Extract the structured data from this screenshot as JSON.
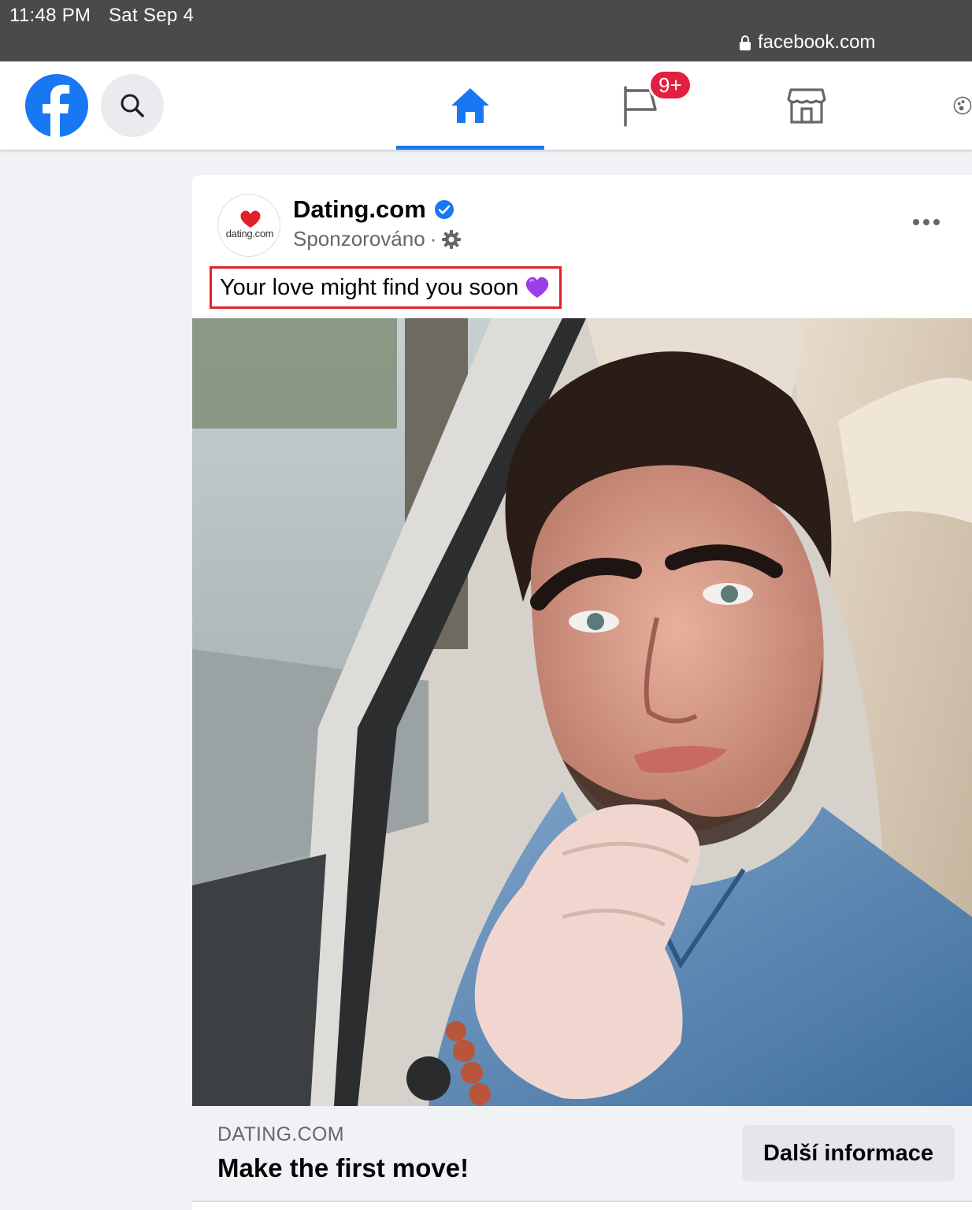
{
  "status_bar": {
    "time": "11:48 PM",
    "date": "Sat Sep 4",
    "url": "facebook.com"
  },
  "nav": {
    "logo_icon": "facebook-logo-icon",
    "search_icon": "search-icon",
    "tabs": [
      {
        "name": "home",
        "icon": "home-icon",
        "active": true
      },
      {
        "name": "pages",
        "icon": "flag-icon",
        "badge": "9+"
      },
      {
        "name": "marketplace",
        "icon": "store-icon"
      },
      {
        "name": "groups",
        "icon": "groups-icon"
      }
    ],
    "accent_color": "#1877f2",
    "badge_color": "#e41e3f"
  },
  "post": {
    "avatar_text": "dating.com",
    "page_name": "Dating.com",
    "verified": true,
    "sponsored_label": "Sponzorováno",
    "separator": "·",
    "settings_icon": "gear-icon",
    "more_icon": "more-icon",
    "text": "Your love might find you soon",
    "emoji": "purple-heart-emoji",
    "highlight_color": "#e4202a",
    "link": {
      "domain": "DATING.COM",
      "headline": "Make the first move!",
      "cta_label": "Další informace"
    }
  }
}
